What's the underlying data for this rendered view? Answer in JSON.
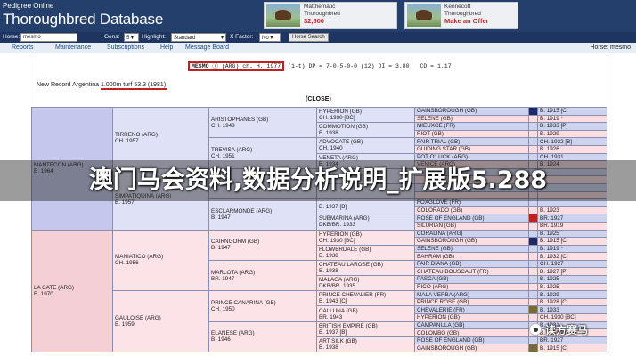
{
  "header": {
    "logo_small": "Pedigree Online",
    "logo_big": "Thoroughbred Database",
    "ads": [
      {
        "name": "Matthematic",
        "type": "Thoroughbred",
        "price": "$2,500"
      },
      {
        "name": "Kennecott",
        "type": "Thoroughbred",
        "price": "Make an Offer"
      }
    ]
  },
  "search": {
    "horse_label": "Horse:",
    "horse_value": "mesmo",
    "gens_label": "Gens:",
    "gens_value": "5",
    "highlight_label": "Highlight:",
    "highlight_value": "Standard",
    "xfactor_label": "X Factor:",
    "xfactor_value": "No",
    "search_button": "Horse Search"
  },
  "nav": {
    "items": [
      "Reports",
      "Maintenance",
      "Subscriptions",
      "Help",
      "Message Board"
    ],
    "user": "Horse: mesmo"
  },
  "summary": {
    "name": "MESMO",
    "circle": "ⓘ",
    "rest": "(ARG) ch. H. 1977",
    "stats": "(1-t) DP = 7-0-5-0-0 (12) DI = 3.80",
    "cd": "CD = 1.17"
  },
  "record": {
    "prefix": "New Record Argentina",
    "highlight": "1.000m turf 53.3 (1981)."
  },
  "close_label": "(CLOSE)",
  "pedigree": {
    "sire": {
      "name": "MANTECON (ARG)",
      "info": "b. 1964"
    },
    "dam": {
      "name": "LA CATE (ARG)",
      "info": "b. 1970"
    },
    "g2": [
      {
        "name": "TIRRENO (ARG)",
        "info": "ch. 1957"
      },
      {
        "name": "SIMPATIQUINA (ARG)",
        "info": "b. 1957"
      },
      {
        "name": "MANIATICO (ARG)",
        "info": "ch. 1956"
      },
      {
        "name": "GAULOISE (ARG)",
        "info": "b. 1959"
      }
    ],
    "g3": [
      {
        "name": "ARISTOPHANES (GB)",
        "info": "ch. 1948"
      },
      {
        "name": "TREVISA (ARG)",
        "info": "ch. 1951"
      },
      {
        "name": "",
        "info": ""
      },
      {
        "name": "ESCLARMONDE (ARG)",
        "info": "b. 1947"
      },
      {
        "name": "CAIRNGORM (GB)",
        "info": "b. 1947"
      },
      {
        "name": "MARLOTA (ARG)",
        "info": "br. 1947"
      },
      {
        "name": "PRINCE CANARINA (GB)",
        "info": "ch. 1950"
      },
      {
        "name": "ELANESE (ARG)",
        "info": "b. 1946"
      }
    ],
    "g4": [
      {
        "name": "HYPERION (GB)",
        "info": "ch. 1930 [BC]"
      },
      {
        "name": "COMMOTION (GB)",
        "info": "b. 1938"
      },
      {
        "name": "ADVOCATE (GB)",
        "info": "ch. 1940"
      },
      {
        "name": "VENETA (ARG)",
        "info": "b. 1934"
      },
      {
        "name": "",
        "info": ""
      },
      {
        "name": "",
        "info": ""
      },
      {
        "name": "",
        "info": "b. 1937 [B]"
      },
      {
        "name": "SUBMARINA (ARG)",
        "info": "dkb/br. 1933"
      },
      {
        "name": "HYPERION (GB)",
        "info": "ch. 1930 [BC]"
      },
      {
        "name": "FLOWERDALE (GB)",
        "info": "b. 1938"
      },
      {
        "name": "CHATEAU LAROSE (GB)",
        "info": "b. 1938"
      },
      {
        "name": "MALAGA (ARG)",
        "info": "dkb/br. 1935"
      },
      {
        "name": "PRINCE CHEVALIER (FR)",
        "info": "b. 1943 [C]"
      },
      {
        "name": "CALLUNA (GB)",
        "info": "br. 1943"
      },
      {
        "name": "BRITISH EMPIRE (GB)",
        "info": "b. 1937 [B]"
      },
      {
        "name": "ART SILK (GB)",
        "info": "b. 1938"
      }
    ],
    "g5": [
      {
        "name": "GAINSBOROUGH (GB)",
        "info": "b. 1915 [C]"
      },
      {
        "name": "SELENE (GB)",
        "info": "b. 1919 *"
      },
      {
        "name": "MIEUXCE (FR)",
        "info": "b. 1933 [P]"
      },
      {
        "name": "RIOT (GB)",
        "info": "b. 1929"
      },
      {
        "name": "FAIR TRIAL (GB)",
        "info": "ch. 1932 [B]"
      },
      {
        "name": "GUIDING STAR (GB)",
        "info": "b. 1926"
      },
      {
        "name": "POT O'LUCK (ARG)",
        "info": "ch. 1931"
      },
      {
        "name": "VENICE (ARG)",
        "info": "b. 1924"
      },
      {
        "name": "",
        "info": ""
      },
      {
        "name": "",
        "info": ""
      },
      {
        "name": "",
        "info": ""
      },
      {
        "name": "",
        "info": ""
      },
      {
        "name": "FOXGLOVE (FR)",
        "info": ""
      },
      {
        "name": "COLORADO (GB)",
        "info": "b. 1923"
      },
      {
        "name": "ROSE OF ENGLAND (GB)",
        "info": "br. 1927"
      },
      {
        "name": "SILURIAN (GB)",
        "info": "br. 1919"
      },
      {
        "name": "CORALINA (ARG)",
        "info": "b. 1925"
      },
      {
        "name": "GAINSBOROUGH (GB)",
        "info": "b. 1915 [C]"
      },
      {
        "name": "SELENE (GB)",
        "info": "b. 1919 *"
      },
      {
        "name": "BAHRAM (GB)",
        "info": "b. 1932 [C]"
      },
      {
        "name": "FAIR DIANA (GB)",
        "info": "ch. 1927"
      },
      {
        "name": "CHATEAU BOUSCAUT (FR)",
        "info": "b. 1927 [P]"
      },
      {
        "name": "PASCA (GB)",
        "info": "b. 1925"
      },
      {
        "name": "RICO (ARG)",
        "info": "b. 1925"
      },
      {
        "name": "MALA VERBA (ARG)",
        "info": "b. 1929"
      },
      {
        "name": "PRINCE ROSE (GB)",
        "info": "b. 1928 [C]"
      },
      {
        "name": "CHEVALERIE (FR)",
        "info": "b. 1933"
      },
      {
        "name": "HYPERION (GB)",
        "info": "ch. 1930 [BC]"
      },
      {
        "name": "CAMPANULA (GB)",
        "info": "b. 1931"
      },
      {
        "name": "COLOMBO (GB)",
        "info": "b. 1931 [B]"
      },
      {
        "name": "ROSE OF ENGLAND (GB)",
        "info": "br. 1927"
      },
      {
        "name": "GAINSBOROUGH (GB)",
        "info": "b. 1915 [C]"
      }
    ]
  },
  "overlay": {
    "banner_text": "澳门马会资料,数据分析说明_扩展版5.288",
    "watermark": "读方赛马"
  },
  "colors": {
    "header_bg": "#243f6b",
    "sire_bg": "#c5c8ec",
    "dam_bg": "#f4cfd5",
    "highlight_red": "#c02020"
  }
}
